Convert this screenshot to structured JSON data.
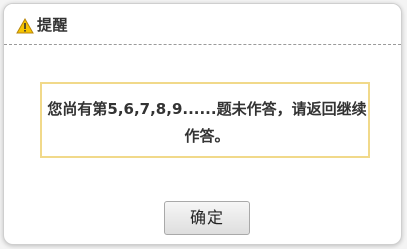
{
  "dialog": {
    "title": "提醒",
    "icon": "warning-icon",
    "message": "您尚有第5,6,7,8,9......题未作答，请返回继续作答。",
    "ok_label": "确定"
  },
  "colors": {
    "message_border": "#f1d98a",
    "warning_fill": "#f6c400",
    "title_separator": "#9a9a9a"
  }
}
